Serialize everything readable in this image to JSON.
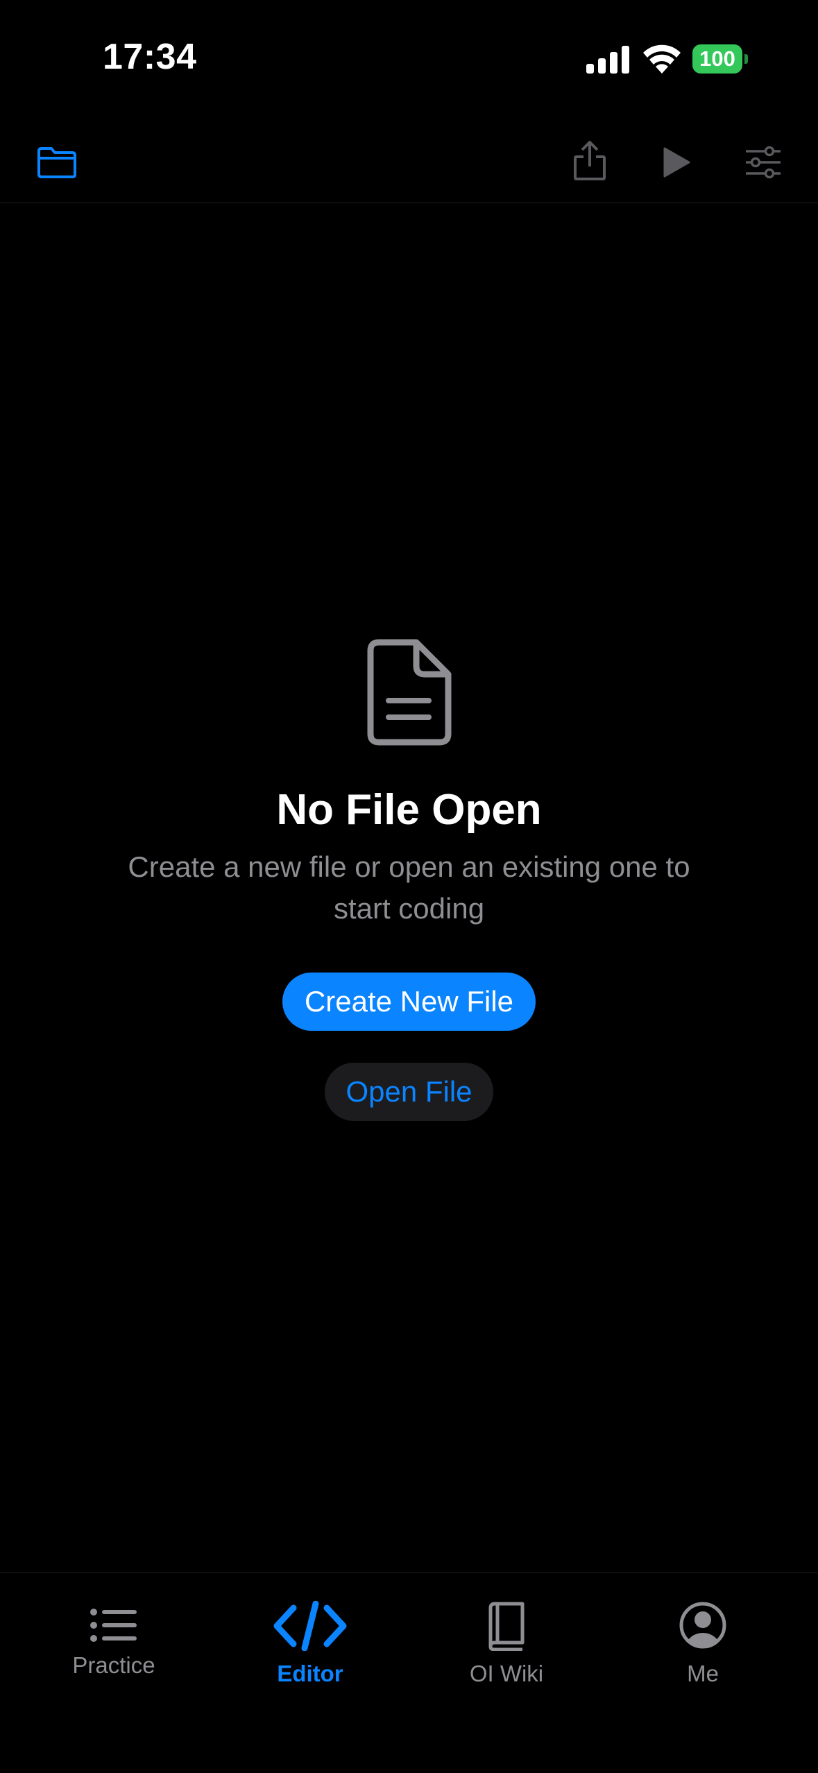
{
  "status_bar": {
    "time": "17:34",
    "battery": "100"
  },
  "toolbar": {
    "icons": [
      "folder-icon",
      "share-icon",
      "play-icon",
      "sliders-icon"
    ]
  },
  "empty_state": {
    "title": "No File Open",
    "subtitle": "Create a new file or open an existing one to start coding",
    "create_label": "Create New File",
    "open_label": "Open File"
  },
  "tabs": [
    {
      "label": "Practice",
      "icon": "list-icon",
      "active": false
    },
    {
      "label": "Editor",
      "icon": "code-icon",
      "active": true
    },
    {
      "label": "OI Wiki",
      "icon": "book-icon",
      "active": false
    },
    {
      "label": "Me",
      "icon": "person-icon",
      "active": false
    }
  ],
  "colors": {
    "accent": "#0A84FF",
    "background": "#000000",
    "secondary_text": "#8E8E93",
    "battery": "#34C759"
  }
}
